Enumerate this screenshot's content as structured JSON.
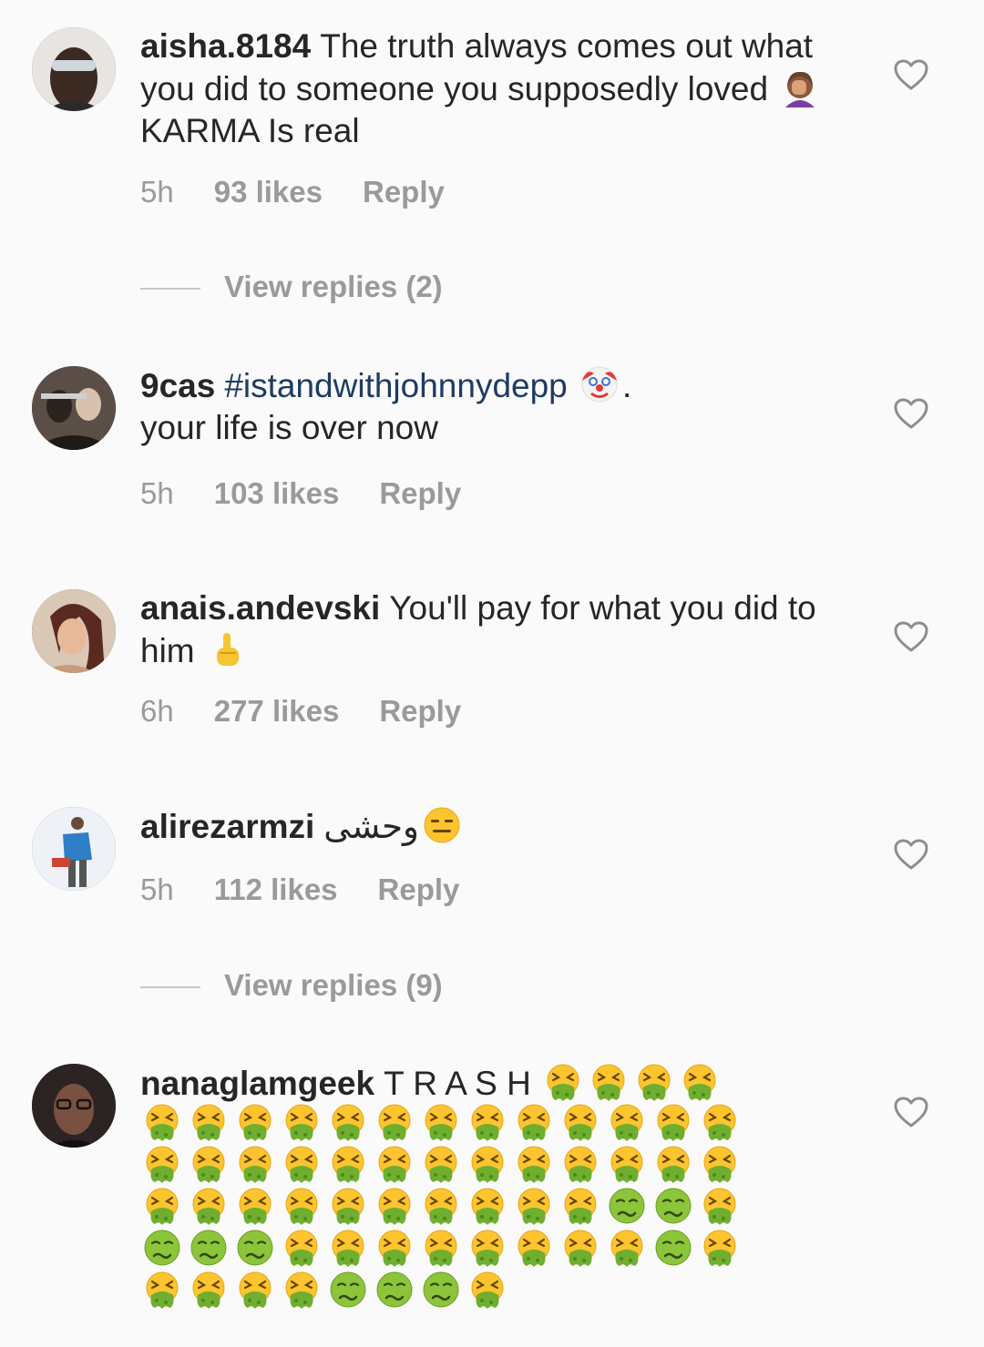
{
  "comments": [
    {
      "username": "aisha.8184",
      "text_part1": "The truth always comes out what you did to someone you supposedly loved",
      "emoji": "facepalm-woman",
      "text_part2": "KARMA Is real",
      "time": "5h",
      "likes": "93 likes",
      "reply": "Reply",
      "view_replies": "View replies (2)"
    },
    {
      "username": "9cas",
      "hashtag": "#istandwithjohnnydepp",
      "emoji": "clown-face",
      "text_after_emoji": ".",
      "text_line2": "your life is over now",
      "time": "5h",
      "likes": "103 likes",
      "reply": "Reply"
    },
    {
      "username": "anais.andevski",
      "text": "You'll pay for what you did to him",
      "emoji": "middle-finger",
      "time": "6h",
      "likes": "277 likes",
      "reply": "Reply"
    },
    {
      "username": "alirezarmzi",
      "text": "وحشی",
      "emoji": "expressionless-face",
      "time": "5h",
      "likes": "112 likes",
      "reply": "Reply",
      "view_replies": "View replies (9)"
    },
    {
      "username": "nanaglamgeek",
      "text": "T R A S H",
      "emoji": "vomiting-face"
    }
  ],
  "colors": {
    "background": "#fafafa",
    "text": "#262626",
    "muted": "#9a9a9a",
    "hashtag": "#1e3b63"
  }
}
